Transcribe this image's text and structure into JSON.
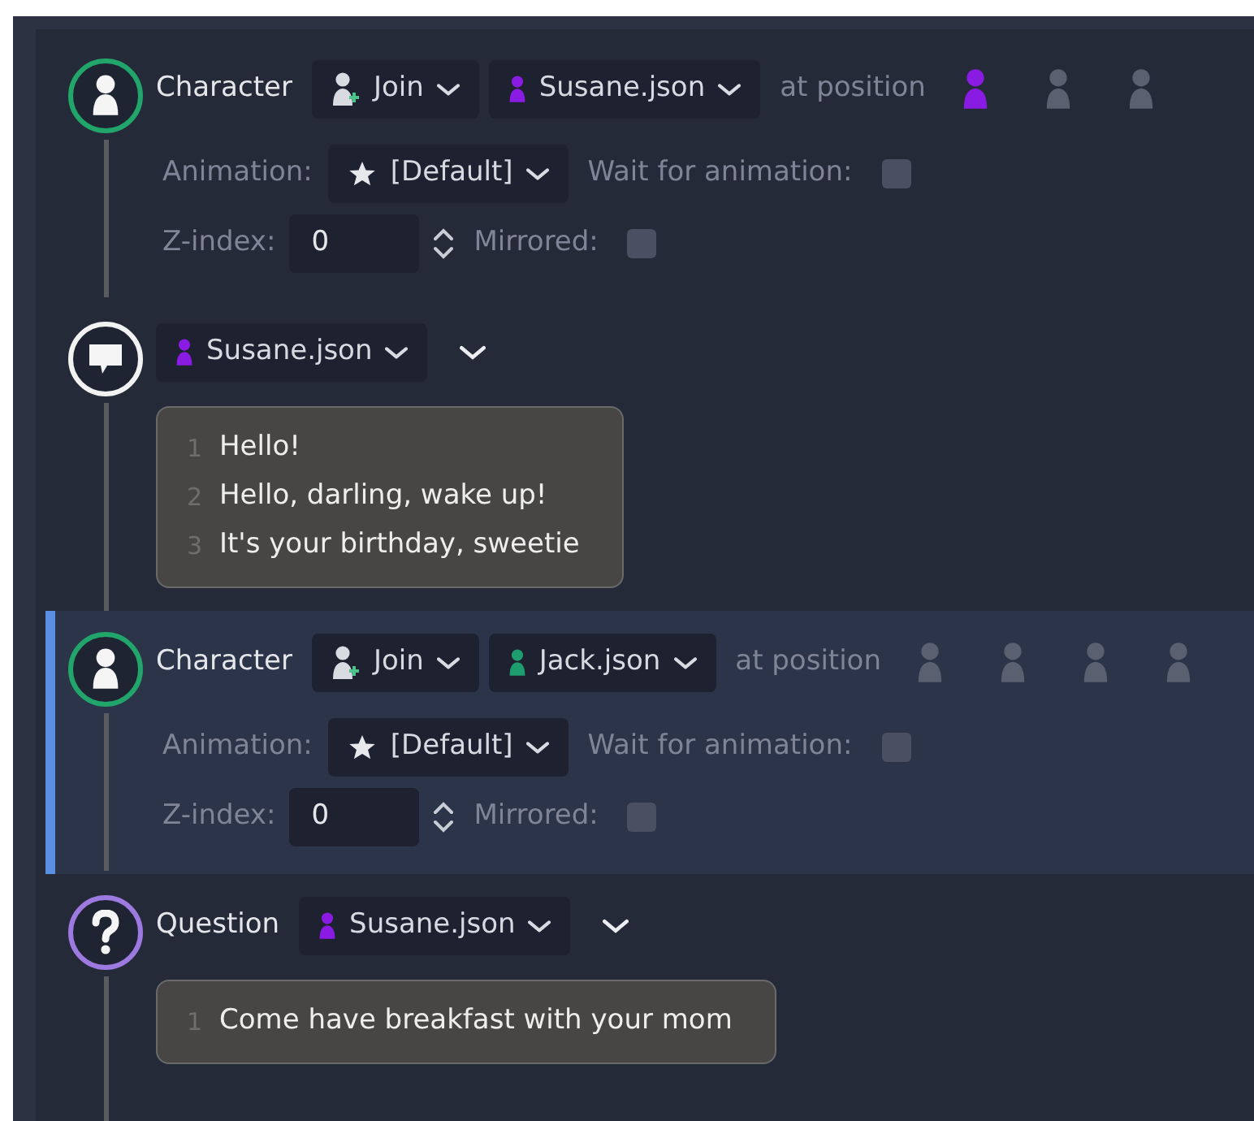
{
  "events": [
    {
      "kind": "character",
      "selected": false,
      "title": "Character",
      "action": "Join",
      "character": {
        "name": "Susane.json",
        "color": "#8a1be2"
      },
      "position_label": "at position",
      "positions": [
        {
          "selected": true
        },
        {
          "selected": false
        },
        {
          "selected": false
        }
      ],
      "animation_label": "Animation:",
      "animation": "[Default]",
      "wait_label": "Wait for animation:",
      "wait_checked": false,
      "z_label": "Z-index:",
      "z_value": "0",
      "mirrored_label": "Mirrored:",
      "mirrored_checked": false
    },
    {
      "kind": "text",
      "selected": false,
      "character": {
        "name": "Susane.json",
        "color": "#8a1be2"
      },
      "lines": [
        {
          "number": "1",
          "text": "Hello!"
        },
        {
          "number": "2",
          "text": "Hello, darling, wake up!"
        },
        {
          "number": "3",
          "text": "It's your birthday, sweetie"
        }
      ]
    },
    {
      "kind": "character",
      "selected": true,
      "title": "Character",
      "action": "Join",
      "character": {
        "name": "Jack.json",
        "color": "#1e9e6e"
      },
      "position_label": "at position",
      "positions": [
        {
          "selected": false
        },
        {
          "selected": false
        },
        {
          "selected": false
        },
        {
          "selected": false
        }
      ],
      "animation_label": "Animation:",
      "animation": "[Default]",
      "wait_label": "Wait for animation:",
      "wait_checked": false,
      "z_label": "Z-index:",
      "z_value": "0",
      "mirrored_label": "Mirrored:",
      "mirrored_checked": false
    },
    {
      "kind": "question",
      "selected": false,
      "title": "Question",
      "character": {
        "name": "Susane.json",
        "color": "#8a1be2"
      },
      "lines": [
        {
          "number": "1",
          "text": "Come have breakfast with your mom"
        }
      ]
    }
  ]
}
